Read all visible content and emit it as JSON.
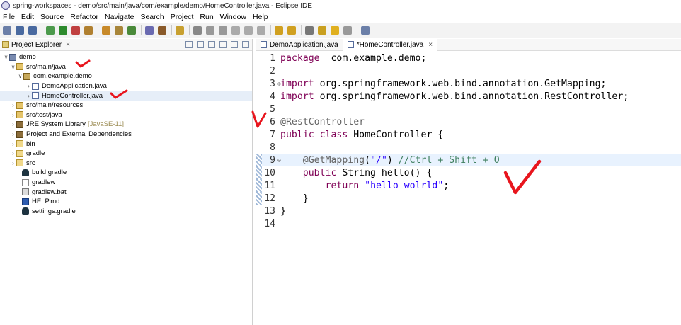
{
  "window": {
    "title": "spring-workspaces - demo/src/main/java/com/example/demo/HomeController.java - Eclipse IDE"
  },
  "menu": [
    "File",
    "Edit",
    "Source",
    "Refactor",
    "Navigate",
    "Search",
    "Project",
    "Run",
    "Window",
    "Help"
  ],
  "explorer": {
    "title": "Project Explorer",
    "close": "×",
    "items": [
      {
        "label": "demo",
        "icon": "project-icon",
        "arrow": "∨"
      },
      {
        "label": "src/main/java",
        "icon": "source-folder-icon",
        "arrow": "∨"
      },
      {
        "label": "com.example.demo",
        "icon": "package-icon",
        "arrow": "∨"
      },
      {
        "label": "DemoApplication.java",
        "icon": "java-file-icon",
        "arrow": "›"
      },
      {
        "label": "HomeController.java",
        "icon": "java-file-icon",
        "arrow": "›"
      },
      {
        "label": "src/main/resources",
        "icon": "source-folder-icon",
        "arrow": "›"
      },
      {
        "label": "src/test/java",
        "icon": "source-folder-icon",
        "arrow": "›"
      },
      {
        "label": "JRE System Library",
        "extra": "[JavaSE-11]",
        "icon": "library-icon",
        "arrow": "›"
      },
      {
        "label": "Project and External Dependencies",
        "icon": "library-icon",
        "arrow": "›"
      },
      {
        "label": "bin",
        "icon": "folder-icon",
        "arrow": "›"
      },
      {
        "label": "gradle",
        "icon": "folder-icon",
        "arrow": "›"
      },
      {
        "label": "src",
        "icon": "folder-icon",
        "arrow": "›"
      },
      {
        "label": "build.gradle",
        "icon": "gradle-icon",
        "arrow": ""
      },
      {
        "label": "gradlew",
        "icon": "text-file-icon",
        "arrow": ""
      },
      {
        "label": "gradlew.bat",
        "icon": "bat-file-icon",
        "arrow": ""
      },
      {
        "label": "HELP.md",
        "icon": "markdown-icon",
        "arrow": ""
      },
      {
        "label": "settings.gradle",
        "icon": "gradle-icon",
        "arrow": ""
      }
    ]
  },
  "editor": {
    "tabs": [
      {
        "label": "DemoApplication.java",
        "close": ""
      },
      {
        "label": "*HomeController.java",
        "close": "×"
      }
    ],
    "lines": [
      {
        "n": "1",
        "parts": [
          [
            "kw",
            "package"
          ],
          [
            "",
            "  com.example.demo;"
          ]
        ]
      },
      {
        "n": "2",
        "parts": []
      },
      {
        "n": "3",
        "fold": "⊕",
        "parts": [
          [
            "kw",
            "import"
          ],
          [
            "",
            " org.springframework.web.bind.annotation.GetMapping;"
          ]
        ]
      },
      {
        "n": "4",
        "parts": [
          [
            "kw",
            "import"
          ],
          [
            "",
            " org.springframework.web.bind.annotation.RestController;"
          ]
        ]
      },
      {
        "n": "5",
        "parts": []
      },
      {
        "n": "6",
        "parts": [
          [
            "ann",
            "@RestController"
          ]
        ]
      },
      {
        "n": "7",
        "parts": [
          [
            "kw",
            "public"
          ],
          [
            "",
            " "
          ],
          [
            "kw",
            "class"
          ],
          [
            "",
            " HomeController {"
          ]
        ]
      },
      {
        "n": "8",
        "parts": []
      },
      {
        "n": "9",
        "fold": "⊖",
        "parts": [
          [
            "",
            "    "
          ],
          [
            "ann",
            "@GetMapping"
          ],
          [
            "",
            "("
          ],
          [
            "str",
            "\"/\""
          ],
          [
            ") "
          ],
          [
            "cmt",
            "//Ctrl + Shift + O"
          ]
        ]
      },
      {
        "n": "10",
        "parts": [
          [
            "",
            "    "
          ],
          [
            "kw",
            "public"
          ],
          [
            "",
            " String hello() {"
          ]
        ]
      },
      {
        "n": "11",
        "parts": [
          [
            "",
            "        "
          ],
          [
            "kw",
            "return"
          ],
          [
            "",
            " "
          ],
          [
            "str",
            "\"hello wolrld\""
          ],
          [
            "",
            ";"
          ]
        ]
      },
      {
        "n": "12",
        "parts": [
          [
            "",
            "    }"
          ]
        ]
      },
      {
        "n": "13",
        "parts": [
          [
            "",
            "}"
          ]
        ]
      },
      {
        "n": "14",
        "parts": []
      }
    ]
  }
}
